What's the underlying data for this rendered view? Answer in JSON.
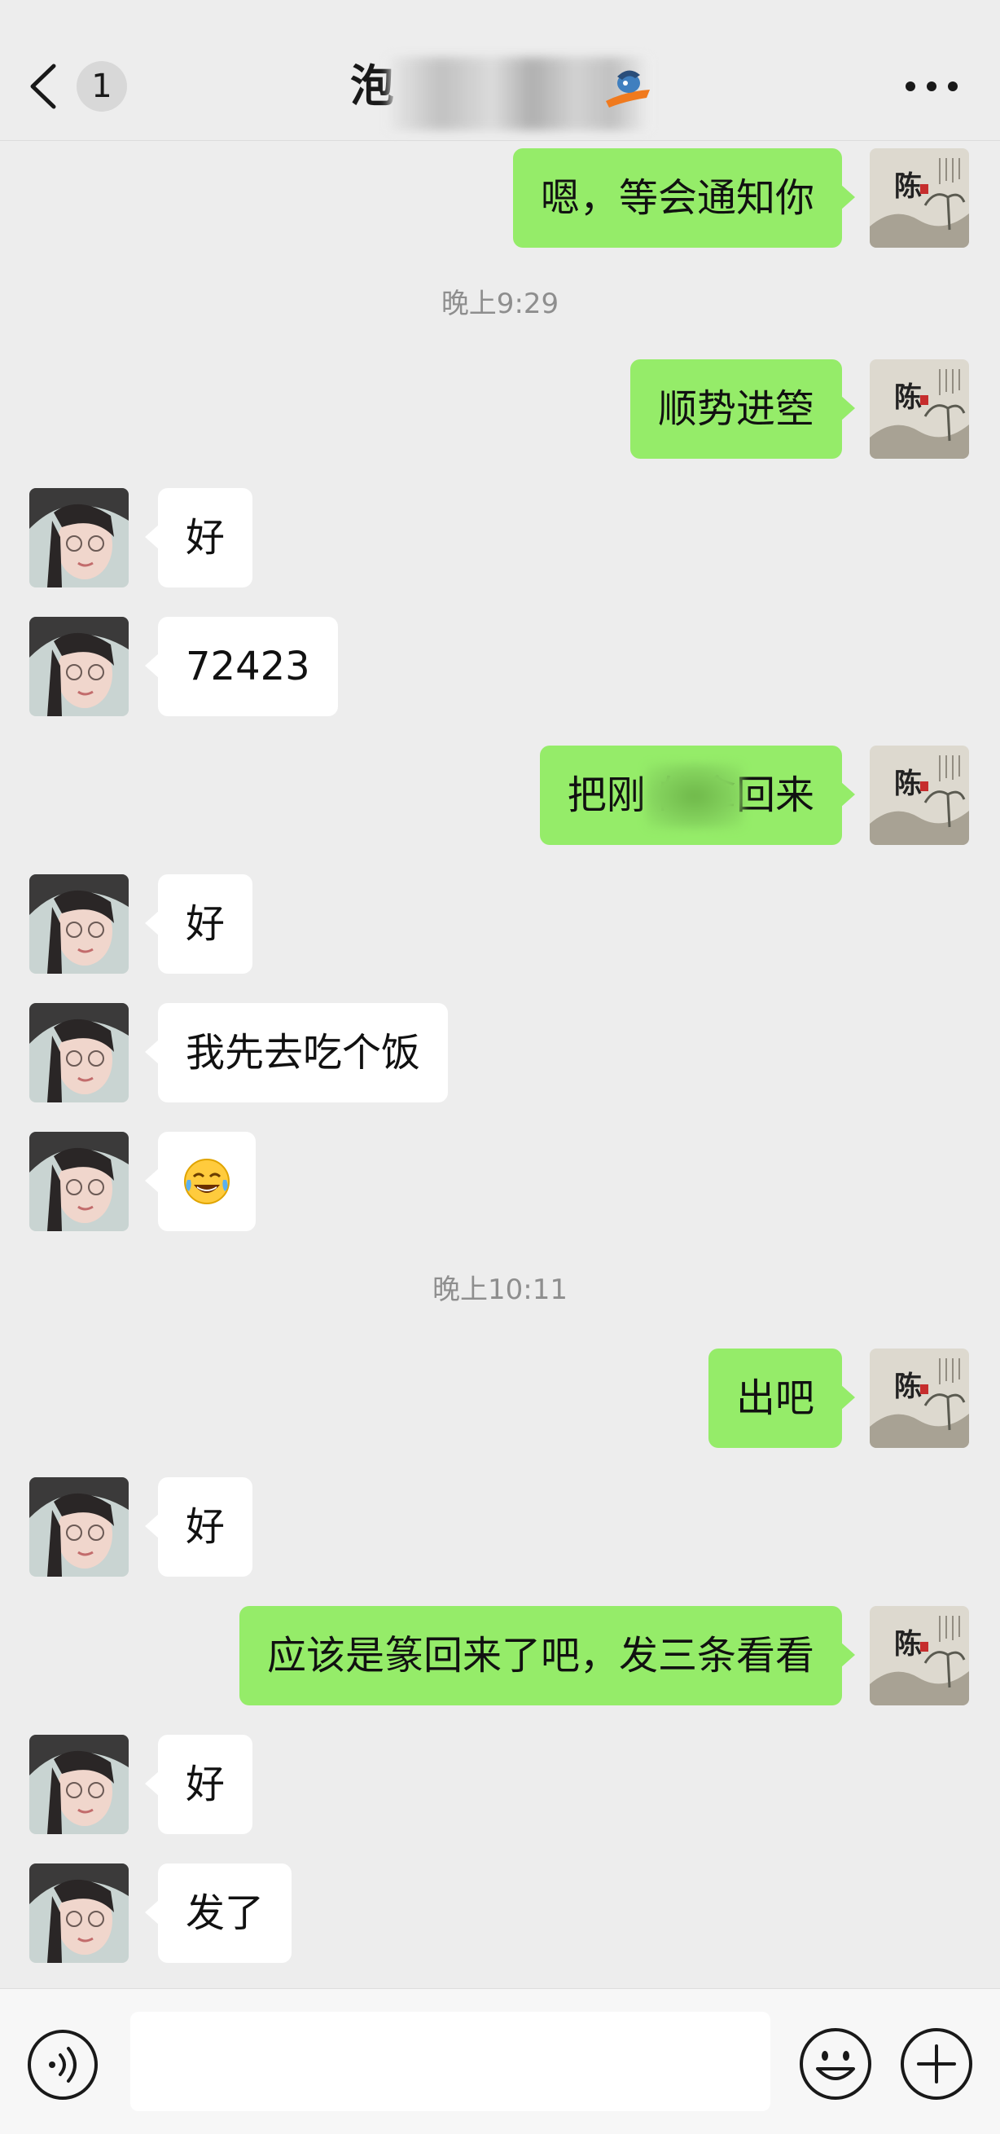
{
  "header": {
    "unread_count": "1",
    "title": "泡",
    "icons": {
      "back": "chevron-left-icon",
      "more": "more-dots-icon"
    }
  },
  "messages": [
    {
      "side": "me",
      "text": "嗯，等会通知你"
    },
    {
      "timestamp": "晚上9:29"
    },
    {
      "side": "me",
      "text": "顺势进箜"
    },
    {
      "side": "her",
      "text": "好"
    },
    {
      "side": "her",
      "text": "72423"
    },
    {
      "side": "me",
      "text": "把刚 的拿回来"
    },
    {
      "side": "her",
      "text": "好"
    },
    {
      "side": "her",
      "text": "我先去吃个饭"
    },
    {
      "side": "her",
      "text": "😂"
    },
    {
      "timestamp": "晚上10:11"
    },
    {
      "side": "me",
      "text": "出吧"
    },
    {
      "side": "her",
      "text": "好"
    },
    {
      "side": "me",
      "text": "应该是篆回来了吧，发三条看看"
    },
    {
      "side": "her",
      "text": "好"
    },
    {
      "side": "her",
      "text": "发了"
    }
  ],
  "my_avatar_text": "陈",
  "input": {
    "value": "",
    "placeholder": ""
  },
  "colors": {
    "background": "#ededed",
    "my_bubble": "#95ec69",
    "her_bubble": "#ffffff",
    "timestamp": "#8e8e8e"
  },
  "icons": {
    "voice": "voice-icon",
    "emoji": "emoji-icon",
    "plus": "plus-icon"
  }
}
